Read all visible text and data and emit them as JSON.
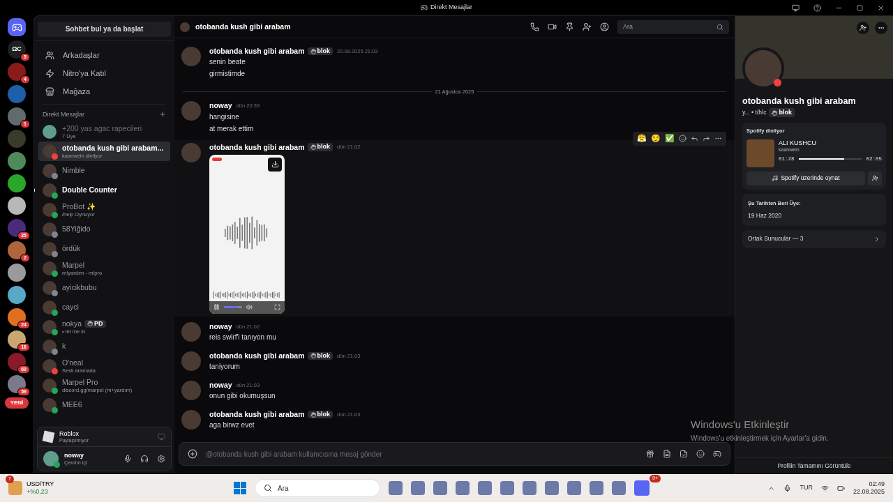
{
  "title_bar": {
    "title": "Direkt Mesajlar"
  },
  "servers": [
    {
      "initials": "ΩC",
      "badge": "5",
      "color": "#1e1f22"
    },
    {
      "badge": "4",
      "color": "#8b1a1a"
    },
    {
      "color": "#1d5fa8"
    },
    {
      "badge": "1",
      "color": "#5f6b6d"
    },
    {
      "color": "#3a3a2a"
    },
    {
      "color": "#4f8a5a"
    },
    {
      "color": "#2aa62a"
    },
    {
      "color": "#b8b8b8"
    },
    {
      "badge": "25",
      "color": "#4a2a7a"
    },
    {
      "badge": "2",
      "color": "#b0643c"
    },
    {
      "color": "#9a9a9a"
    },
    {
      "color": "#5aa8c8"
    },
    {
      "badge": "24",
      "color": "#e07020"
    },
    {
      "badge": "16",
      "color": "#c8a870"
    },
    {
      "badge": "69",
      "color": "#8a1a2a"
    },
    {
      "badge": "59",
      "color": "#7a7a8a"
    }
  ],
  "new_pill": "YENİ",
  "sidebar": {
    "search_button": "Sohbet bul ya da başlat",
    "nav": [
      {
        "kind": "friends",
        "label": "Arkadaşlar"
      },
      {
        "kind": "nitro",
        "label": "Nitro'ya Katıl"
      },
      {
        "kind": "shop",
        "label": "Mağaza"
      }
    ],
    "dm_header": "Direkt Mesajlar",
    "dms": [
      {
        "name": "+200 yas agac rapecileri",
        "subtitle": "7 Üye",
        "kind": "group",
        "selected": false,
        "unread": false
      },
      {
        "name": "otobanda kush gibi arabam...",
        "subtitle": "kaanwein dinliyor",
        "kind": "user",
        "color": "#f23f43",
        "selected": true,
        "unread": false
      },
      {
        "name": "Nimble",
        "kind": "user",
        "color": "#80848e",
        "selected": false,
        "unread": false
      },
      {
        "name": "Double Counter",
        "kind": "user",
        "color": "#23a55a",
        "selected": false,
        "unread": true
      },
      {
        "name": "ProBot ✨",
        "subtitle": "/help Oynuyor",
        "kind": "user",
        "color": "#23a55a",
        "selected": false,
        "unread": false
      },
      {
        "name": "58Yiğido",
        "kind": "user",
        "color": "#80848e",
        "selected": false,
        "unread": false
      },
      {
        "name": "ördük",
        "kind": "user",
        "color": "#80848e",
        "selected": false,
        "unread": false
      },
      {
        "name": "Marpel",
        "subtitle": "m!yardım - m!pro",
        "kind": "user",
        "color": "#23a55a",
        "selected": false,
        "unread": false
      },
      {
        "name": "ayicikbubu",
        "kind": "user",
        "color": "#80848e",
        "selected": false,
        "unread": false
      },
      {
        "name": "cayci",
        "kind": "user",
        "color": "#23a55a",
        "selected": false,
        "unread": false
      },
      {
        "name": "nokya",
        "tag": "PD",
        "subtitle": "• let me in",
        "kind": "user",
        "color": "#23a55a",
        "selected": false,
        "unread": false
      },
      {
        "name": "k",
        "kind": "user",
        "color": "#80848e",
        "selected": false,
        "unread": false
      },
      {
        "name": "O'neal",
        "subtitle": "Sesli aramada",
        "kind": "user",
        "color": "#f23f43",
        "selected": false,
        "unread": false
      },
      {
        "name": "Marpel Pro",
        "subtitle": "discord.gg/marpel (m+yardım)",
        "kind": "user",
        "color": "#23a55a",
        "selected": false,
        "unread": false
      },
      {
        "name": "MEE6",
        "kind": "user",
        "color": "#23a55a",
        "selected": false,
        "unread": false
      }
    ],
    "activity": {
      "game": "Roblox",
      "status": "Paylaşılmıyor"
    },
    "user": {
      "name": "noway",
      "status": "Çevrim içi"
    }
  },
  "chat": {
    "header_name": "otobanda kush gibi arabam",
    "search_placeholder": "Ara",
    "reactions": [
      "😤",
      "😌",
      "✅"
    ],
    "items": [
      {
        "kind": "message",
        "author": "otobanda kush gibi arabam",
        "tag": "blok",
        "time": "20.08.2025 21:03",
        "lines": [
          "senin beate",
          "girmistimde"
        ],
        "hovered": false
      },
      {
        "kind": "divider",
        "label": "21 Ağustos 2025"
      },
      {
        "kind": "message",
        "author": "noway",
        "time": "dün 20:39",
        "lines": [
          "hangisine",
          "at merak ettim"
        ],
        "hovered": false
      },
      {
        "kind": "video",
        "author": "otobanda kush gibi arabam",
        "tag": "blok",
        "time": "dün 21:02",
        "hovered": true,
        "level": 0.75
      },
      {
        "kind": "message",
        "author": "noway",
        "time": "dün 21:02",
        "lines": [
          "reis swirf'i tanıyon mu"
        ],
        "hovered": false
      },
      {
        "kind": "message",
        "author": "otobanda kush gibi arabam",
        "tag": "blok",
        "time": "dün 21:03",
        "lines": [
          "taniyorum"
        ],
        "hovered": false
      },
      {
        "kind": "message",
        "author": "noway",
        "time": "dün 21:03",
        "lines": [
          "onun gibi okumuşsun"
        ],
        "hovered": false
      },
      {
        "kind": "message",
        "author": "otobanda kush gibi arabam",
        "tag": "blok",
        "time": "dün 21:03",
        "lines": [
          "aga birwz evet"
        ],
        "hovered": false
      }
    ],
    "composer_placeholder": "@otobanda kush gibi arabam kullanıcısına mesaj gönder"
  },
  "profile": {
    "name": "otobanda kush gibi arabam",
    "about": "y... • t/h/c",
    "tag": "blok",
    "color": "#f23f43",
    "spotify": {
      "heading": "Spotify dinliyor",
      "track": "ALI KUSHCU",
      "artist": "kaanwein",
      "elapsed": "01:28",
      "duration": "02:05",
      "level": 0.72,
      "button": "Spotify üzerinde oynat"
    },
    "member_since_label": "Şu Tarihten Beri Üye:",
    "member_since": "19 Haz 2020",
    "mutual_servers": "Ortak Sunucular — 3",
    "footer": "Profilin Tamamını Görüntüle"
  },
  "activation_notice": {
    "title": "Windows'u Etkinleştir",
    "text": "Windows'u etkinleştirmek için Ayarlar'a gidin."
  },
  "taskbar": {
    "widget_badge": "7",
    "widget_title": "USD/TRY",
    "widget_value": "+%0,23",
    "search": "Ara",
    "discord_badge": "9+",
    "language": "TUR",
    "time": "02:49",
    "date": "22.08.2025"
  }
}
